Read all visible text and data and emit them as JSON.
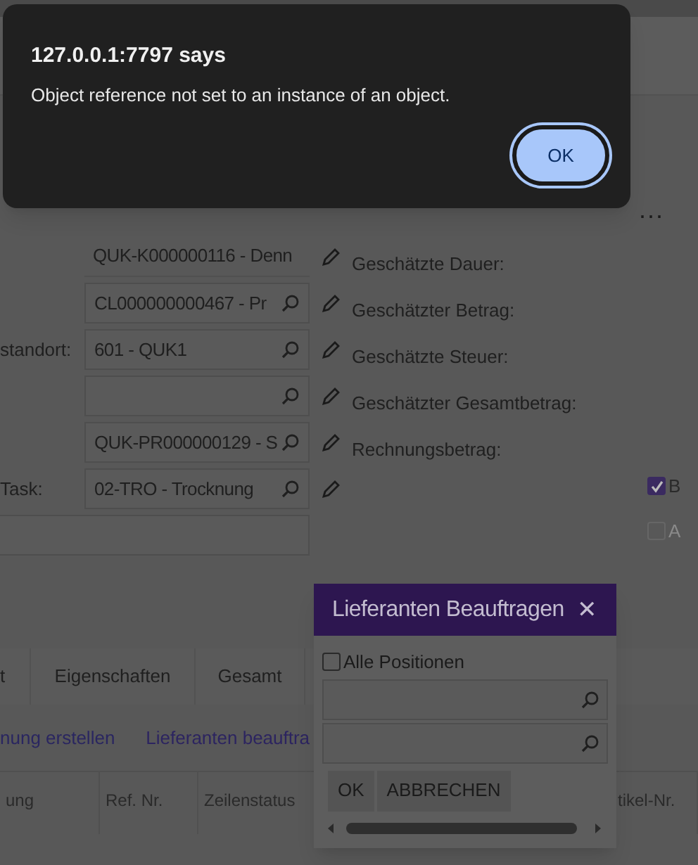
{
  "alert": {
    "title": "127.0.0.1:7797 says",
    "message": "Object reference not set to an instance of an object.",
    "button": "OK"
  },
  "more_menu": "...",
  "form": {
    "rows": [
      {
        "label": "",
        "value": "QUK-K000000116 - Denn",
        "kind": "readonly"
      },
      {
        "label": "",
        "value": "CL000000000467 - Pr",
        "kind": "lookup"
      },
      {
        "label": "standort:",
        "value": "601 - QUK1",
        "kind": "lookup"
      },
      {
        "label": "",
        "value": "",
        "kind": "lookup"
      },
      {
        "label": "",
        "value": "QUK-PR000000129 - S",
        "kind": "lookup"
      },
      {
        "label": "Task:",
        "value": "02-TRO - Trocknung",
        "kind": "lookup"
      }
    ],
    "summary_labels": [
      "Geschätzte Dauer:",
      "Geschätzter Betrag:",
      "Geschätzte Steuer:",
      "Geschätzter Gesamtbetrag:",
      "Rechnungsbetrag:"
    ],
    "options": [
      {
        "label": "B",
        "checked": true,
        "disabled": false
      },
      {
        "label": "A",
        "checked": false,
        "disabled": true
      }
    ]
  },
  "tabs": [
    {
      "label": "t",
      "selected": false
    },
    {
      "label": "Eigenschaften",
      "selected": false
    },
    {
      "label": "Gesamt",
      "selected": false
    }
  ],
  "actions": [
    "nung erstellen",
    "Lieferanten beauftra"
  ],
  "table": {
    "columns": [
      "ung",
      "Ref. Nr.",
      "Zeilenstatus",
      "",
      "tikel-Nr."
    ]
  },
  "modal": {
    "title": "Lieferanten Beauftragen",
    "close": "✕",
    "all_positions": {
      "label": "Alle Positionen",
      "checked": false
    },
    "fields": [
      {
        "kind": "lookup"
      },
      {
        "kind": "lookup"
      }
    ],
    "buttons": [
      "OK",
      "ABBRECHEN"
    ]
  }
}
